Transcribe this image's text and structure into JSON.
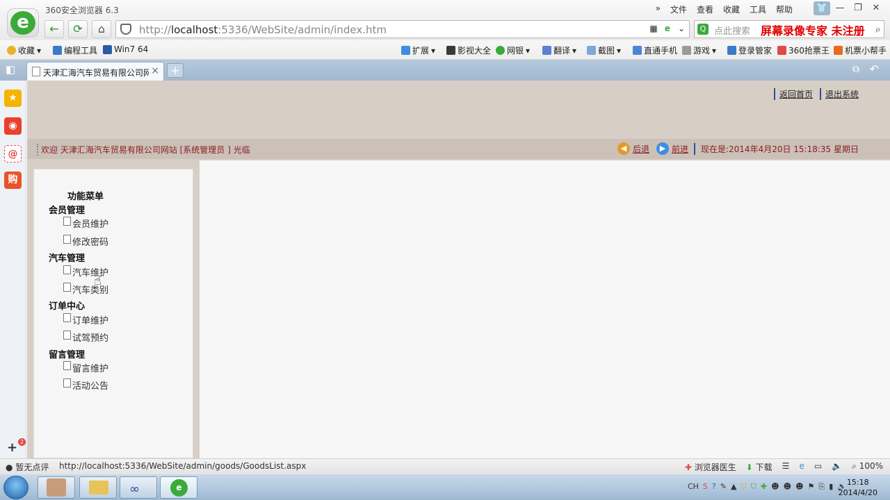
{
  "browser": {
    "title": "360安全浏览器 6.3",
    "menu": [
      "文件",
      "查看",
      "收藏",
      "工具",
      "帮助"
    ],
    "url_prefix": "http://",
    "url_host": "localhost",
    "url_rest": ":5336/WebSite/admin/index.htm",
    "search_placeholder": "点此搜索",
    "watermark": "屏幕录像专家  未注册",
    "colors": {
      "accent": "#3aab38",
      "tabbar": "#a2b8ce",
      "content_bg": "#d7cec6",
      "welcome_text": "#8a1d1d"
    }
  },
  "favorites": {
    "left": [
      "收藏",
      "编程工具",
      "Win7 64"
    ],
    "right": [
      "扩展",
      "影视大全",
      "网银",
      "翻译",
      "截图",
      "直通手机",
      "游戏",
      "登录管家",
      "360抢票王",
      "机票小帮手"
    ]
  },
  "tab": {
    "title": "天津汇海汽车贸易有限公司网站后台",
    "close": "×",
    "new": "+"
  },
  "sidebar": {
    "badge": "2",
    "icons": [
      "star-icon",
      "weibo-icon",
      "mail-icon",
      "shop-icon"
    ]
  },
  "page": {
    "links": [
      "返回首页",
      "退出系统"
    ],
    "welcome": "欢迎  天津汇海汽车贸易有限公司网站  [系统管理员 ] 光临",
    "back": "后退",
    "forward": "前进",
    "now": "现在是:2014年4月20日  15:18:35 星期日"
  },
  "menu": {
    "title": "功能菜单",
    "groups": [
      {
        "label": "会员管理",
        "items": [
          "会员维护",
          "修改密码"
        ]
      },
      {
        "label": "汽车管理",
        "items": [
          "汽车维护",
          "汽车类别"
        ]
      },
      {
        "label": "订单中心",
        "items": [
          "订单维护",
          "试驾预约"
        ]
      },
      {
        "label": "留言管理",
        "items": [
          "留言维护",
          "活动公告"
        ]
      }
    ]
  },
  "status": {
    "left": "暂无点评",
    "url": "http://localhost:5336/WebSite/admin/goods/GoodsList.aspx",
    "doctor": "浏览器医生",
    "download": "下载",
    "zoom": "100%"
  },
  "taskbar": {
    "time": "15:18",
    "date": "2014/4/20",
    "lang": "CH"
  }
}
